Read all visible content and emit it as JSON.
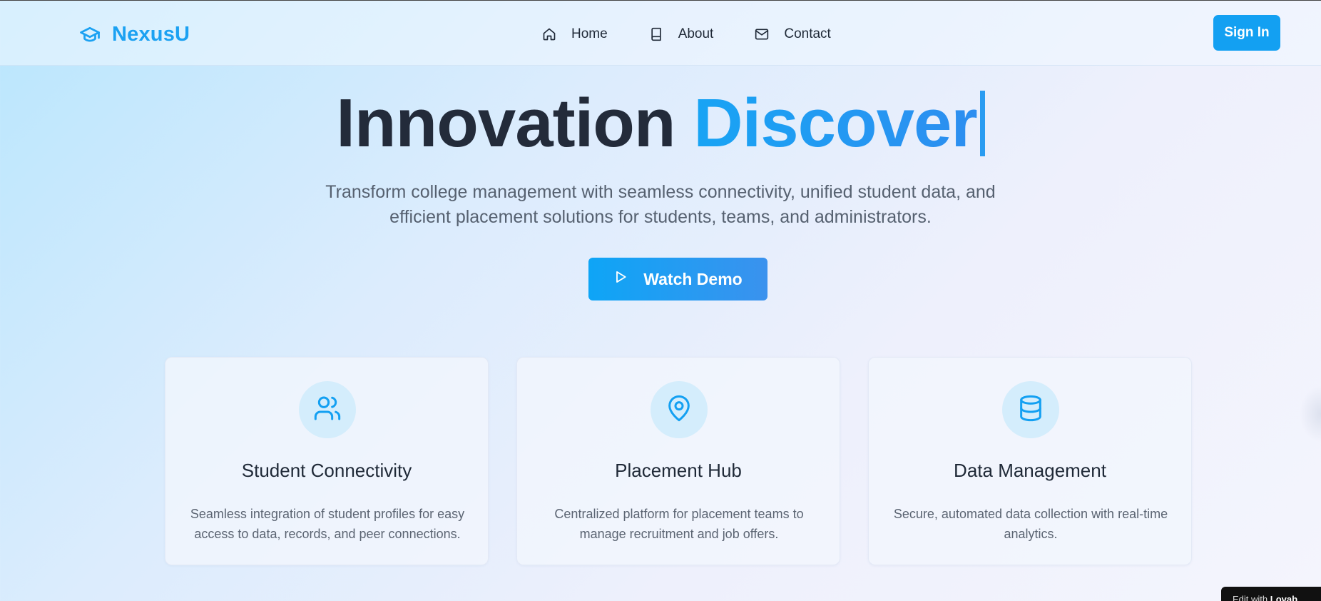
{
  "brand": {
    "name": "NexusU",
    "icon": "graduation-cap-icon"
  },
  "nav": {
    "items": [
      {
        "label": "Home",
        "icon": "home-icon"
      },
      {
        "label": "About",
        "icon": "book-icon"
      },
      {
        "label": "Contact",
        "icon": "mail-icon"
      }
    ],
    "signin_label": "Sign In"
  },
  "hero": {
    "title_word1": "Innovation",
    "title_word2": "Discover",
    "subtitle": "Transform college management with seamless connectivity, unified student data, and efficient placement solutions for students, teams, and administrators.",
    "demo_label": "Watch Demo"
  },
  "features": [
    {
      "icon": "users-icon",
      "title": "Student Connectivity",
      "text": "Seamless integration of student profiles for easy access to data, records, and peer connections."
    },
    {
      "icon": "map-pin-icon",
      "title": "Placement Hub",
      "text": "Centralized platform for placement teams to manage recruitment and job offers."
    },
    {
      "icon": "database-icon",
      "title": "Data Management",
      "text": "Secure, automated data collection with real-time analytics."
    }
  ],
  "badge": {
    "prefix": "Edit with",
    "brand": "Lovab"
  },
  "colors": {
    "accent": "#13a0f2",
    "text_dark": "#232b3a",
    "text_muted": "#566170"
  }
}
